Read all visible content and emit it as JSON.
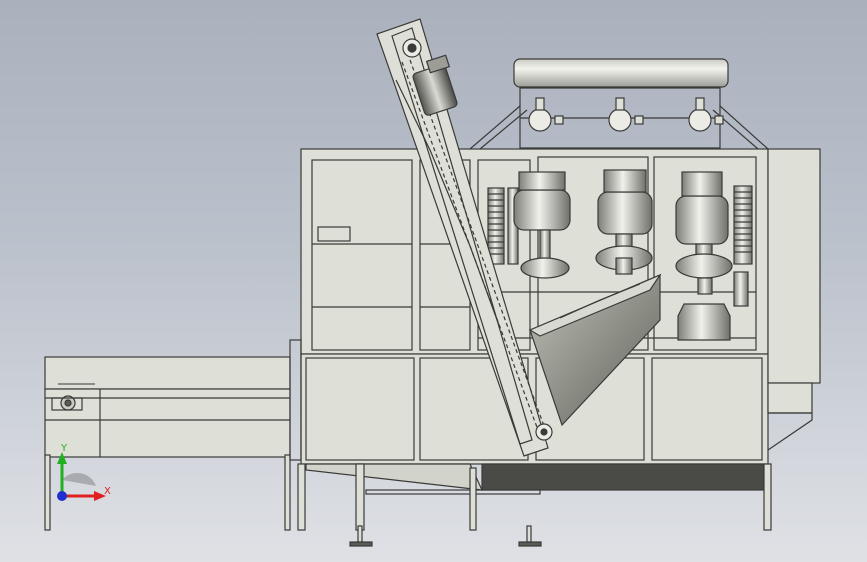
{
  "viewport": {
    "background_top": "#aab1bd",
    "background_bottom": "#dfe1e5"
  },
  "model": {
    "fill_color": "#dedfd6",
    "line_color": "#3a3a38",
    "shade_color": "#8e8f88"
  },
  "triad": {
    "x_label": "X",
    "y_label": "Y",
    "x_color": "#e02020",
    "y_color": "#20b020",
    "z_color": "#2030d0"
  }
}
